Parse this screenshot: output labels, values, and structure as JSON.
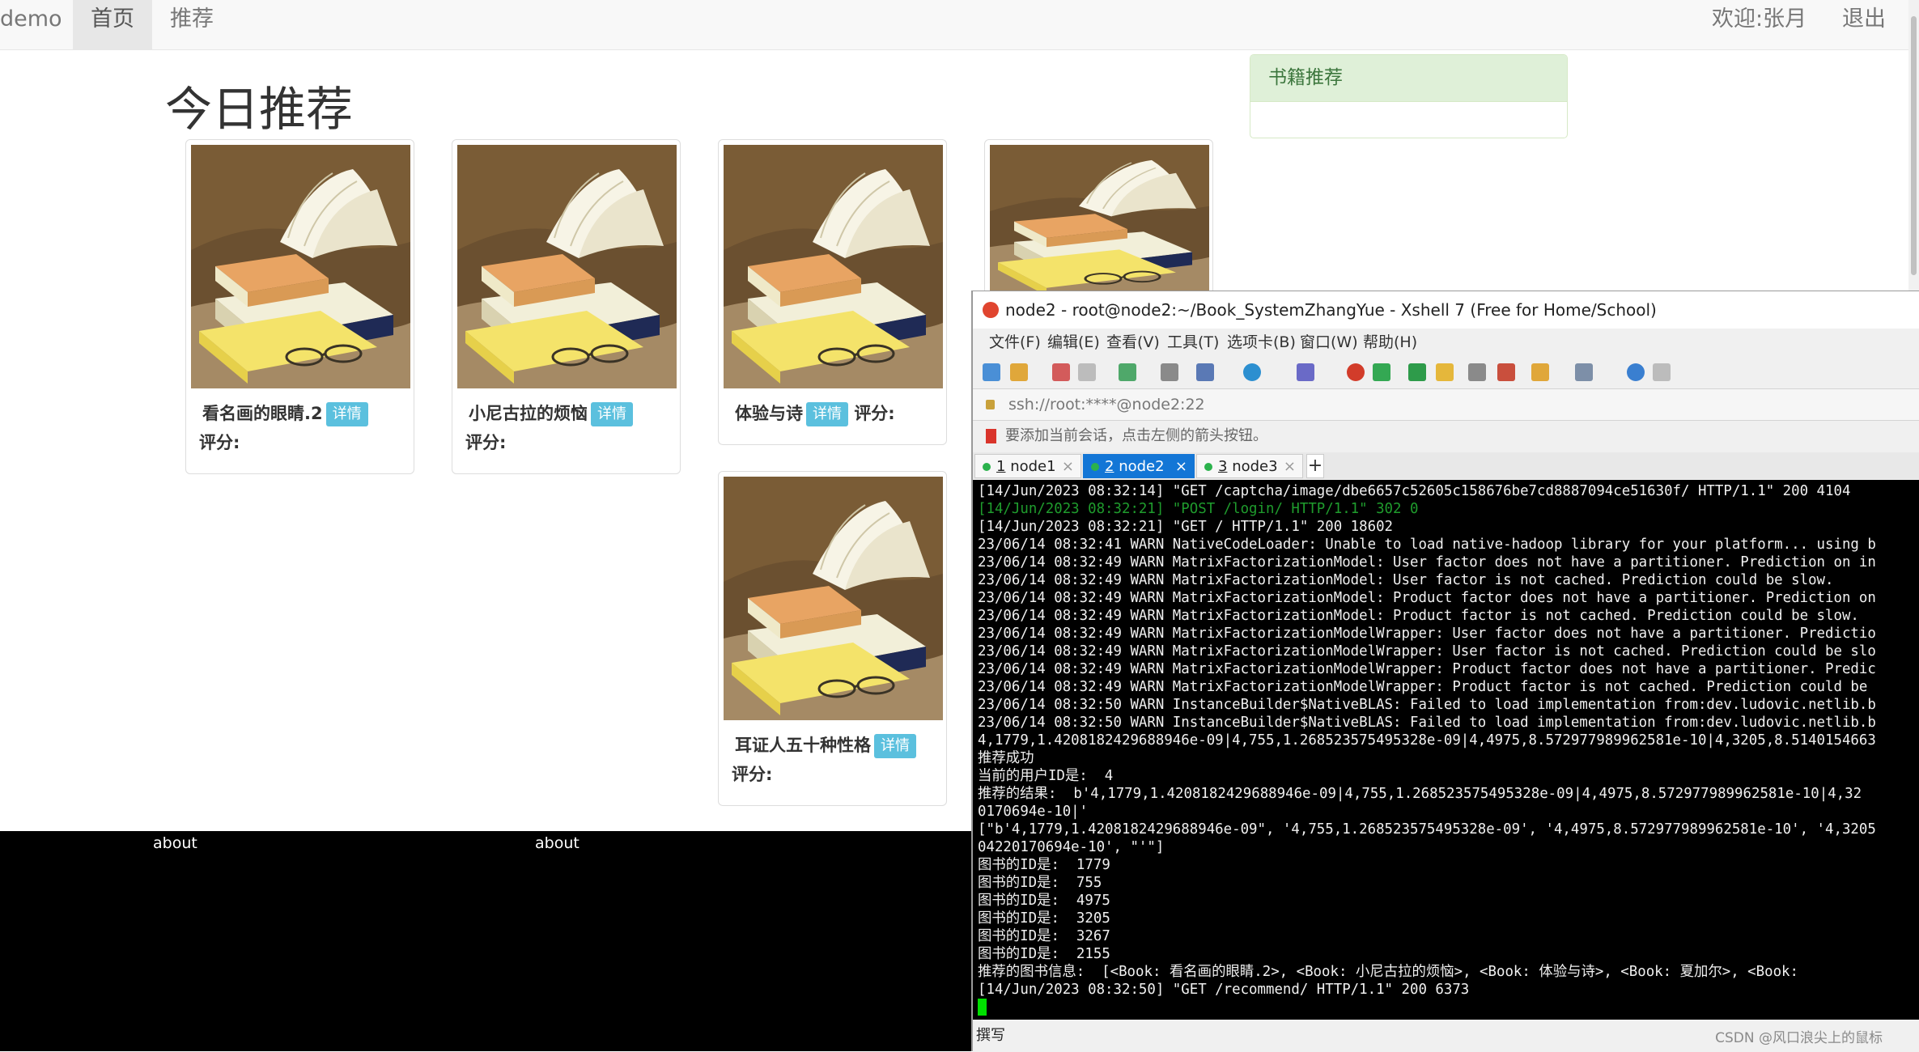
{
  "nav": {
    "brand": "demo",
    "items": [
      "首页",
      "推荐"
    ],
    "welcome": "欢迎:张月",
    "logout": "退出"
  },
  "page_title": "今日推荐",
  "cards": [
    {
      "title": "看名画的眼睛.2",
      "detail": "详情",
      "rating_label": "评分:"
    },
    {
      "title": "小尼古拉的烦恼",
      "detail": "详情",
      "rating_label": "评分:"
    },
    {
      "title": "体验与诗",
      "detail": "详情",
      "rating_label": "评分:"
    },
    {
      "title": "",
      "detail": "",
      "rating_label": ""
    },
    {
      "title": "耳证人五十种性格",
      "detail": "详情",
      "rating_label": "评分:"
    }
  ],
  "side_panel": {
    "heading": "书籍推荐"
  },
  "footer": {
    "links": [
      "about",
      "about"
    ]
  },
  "xshell": {
    "title": "node2 - root@node2:~/Book_SystemZhangYue - Xshell 7 (Free for Home/School)",
    "menu": [
      "文件(F)",
      "编辑(E)",
      "查看(V)",
      "工具(T)",
      "选项卡(B)",
      "窗口(W)",
      "帮助(H)"
    ],
    "address": "ssh://root:****@node2:22",
    "hint": "要添加当前会话，点击左侧的箭头按钮。",
    "tabs": [
      {
        "num": "1",
        "label": "node1",
        "close": "×"
      },
      {
        "num": "2",
        "label": "node2",
        "close": "×"
      },
      {
        "num": "3",
        "label": "node3",
        "close": "×"
      }
    ],
    "tab_add": "+",
    "terminal_lines": [
      "[14/Jun/2023 08:32:14] \"GET /captcha/image/dbe6657c52605c158676be7cd8887094ce51630f/ HTTP/1.1\" 200 4104",
      "[14/Jun/2023 08:32:21] \"POST /login/ HTTP/1.1\" 302 0",
      "[14/Jun/2023 08:32:21] \"GET / HTTP/1.1\" 200 18602",
      "23/06/14 08:32:41 WARN NativeCodeLoader: Unable to load native-hadoop library for your platform... using b",
      "23/06/14 08:32:49 WARN MatrixFactorizationModel: User factor does not have a partitioner. Prediction on in",
      "23/06/14 08:32:49 WARN MatrixFactorizationModel: User factor is not cached. Prediction could be slow.",
      "23/06/14 08:32:49 WARN MatrixFactorizationModel: Product factor does not have a partitioner. Prediction on",
      "23/06/14 08:32:49 WARN MatrixFactorizationModel: Product factor is not cached. Prediction could be slow.",
      "23/06/14 08:32:49 WARN MatrixFactorizationModelWrapper: User factor does not have a partitioner. Predictio",
      "23/06/14 08:32:49 WARN MatrixFactorizationModelWrapper: User factor is not cached. Prediction could be slo",
      "23/06/14 08:32:49 WARN MatrixFactorizationModelWrapper: Product factor does not have a partitioner. Predic",
      "23/06/14 08:32:49 WARN MatrixFactorizationModelWrapper: Product factor is not cached. Prediction could be",
      "23/06/14 08:32:50 WARN InstanceBuilder$NativeBLAS: Failed to load implementation from:dev.ludovic.netlib.b",
      "23/06/14 08:32:50 WARN InstanceBuilder$NativeBLAS: Failed to load implementation from:dev.ludovic.netlib.b",
      "4,1779,1.4208182429688946e-09|4,755,1.268523575495328e-09|4,4975,8.572977989962581e-10|4,3205,8.5140154663",
      "推荐成功",
      "当前的用户ID是:  4",
      "推荐的结果:  b'4,1779,1.4208182429688946e-09|4,755,1.268523575495328e-09|4,4975,8.572977989962581e-10|4,32",
      "0170694e-10|'",
      "[\"b'4,1779,1.4208182429688946e-09\", '4,755,1.268523575495328e-09', '4,4975,8.572977989962581e-10', '4,3205",
      "04220170694e-10', \"'\"]",
      "图书的ID是:  1779",
      "图书的ID是:  755",
      "图书的ID是:  4975",
      "图书的ID是:  3205",
      "图书的ID是:  3267",
      "图书的ID是:  2155",
      "推荐的图书信息:  [<Book: 看名画的眼睛.2>, <Book: 小尼古拉的烦恼>, <Book: 体验与诗>, <Book: 夏加尔>, <Book:",
      "[14/Jun/2023 08:32:50] \"GET /recommend/ HTTP/1.1\" 200 6373"
    ],
    "status": "撰写"
  },
  "watermark": "CSDN @风口浪尖上的鼠标",
  "colors": {
    "accent": "#5bc0de",
    "panel_heading_bg": "#dff0d8",
    "panel_heading_text": "#3c763d",
    "active_tab": "#1376d6"
  }
}
